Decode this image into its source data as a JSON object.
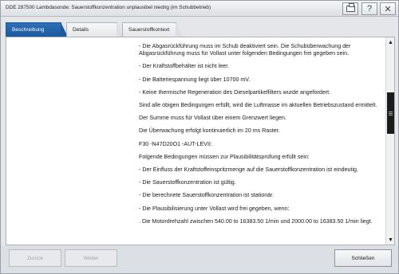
{
  "window": {
    "title": "DDE 287500 Lambdasonde: Sauerstoffkonzentration unplausibel niedrig (im Schubbetrieb)",
    "icons": [
      "printer-icon",
      "help-icon",
      "close-icon"
    ],
    "help_label": "?",
    "close_label": "✕"
  },
  "tabs": [
    {
      "label": "Beschreibung",
      "active": true
    },
    {
      "label": "Details",
      "active": false
    },
    {
      "label": "Sauerstoffkontext",
      "active": false
    }
  ],
  "content": {
    "paragraphs": [
      "- Die Abgasrückführung muss im Schub deaktiviert sein. Die Schubüberwachung der Abgasrückführung muss für Vollast unter folgenden Bedingungen frei gegeben sein.",
      "- Der Kraftstoffbehälter ist nicht leer.",
      "- Die Batteriespannung liegt über 10700 mV.",
      "- Keine thermische Regeneration des Dieselpartikelfilters wurde angefordert.",
      "Sind alle obigen Bedingungen erfüllt, wird die Luftmasse im aktuellen Betriebszustand ermittelt.",
      "Der Summe muss für Vollast über einem Grenzwert liegen.",
      "Die Überwachung erfolgt kontinuierlich im 20 ms Raster.",
      "F30 -N47D20O1 -AUT-LEVII:",
      "Folgende Bedingungen müssen zur Plausibilitätsprüfung erfüllt sein:",
      "- Der Einfluss der Kraftstoffeinspritzmenge auf die Sauerstoffkonzentration ist eindeutig.",
      "- Die Sauerstoffkonzentration ist gültig.",
      "- Die berechnete Sauerstoffkonzentration ist stationär.",
      "- Die Plausibilisierung unter Vollast wird frei gegeben, wenn:",
      ". Die Motordrehzahl zwischen 540.00 to 16383.50 1/min und 2000.00 to 16383.50 1/min liegt."
    ]
  },
  "scrollbar": {
    "up_label": "▲",
    "down_label": "▼"
  },
  "footer": {
    "back_label": "Zurück",
    "next_label": "Weiter",
    "close_label": "Schließen"
  }
}
